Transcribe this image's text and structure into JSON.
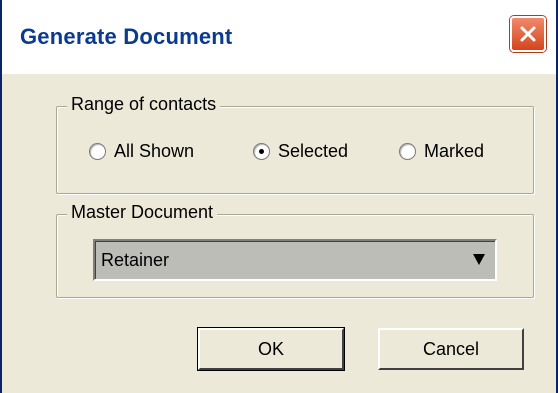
{
  "window": {
    "title": "Generate Document",
    "close_icon": "close-icon"
  },
  "range_group": {
    "label": "Range of contacts",
    "options": [
      {
        "label": "All Shown",
        "checked": false
      },
      {
        "label": "Selected",
        "checked": true
      },
      {
        "label": "Marked",
        "checked": false
      }
    ]
  },
  "master_group": {
    "label": "Master Document",
    "selected_value": "Retainer",
    "arrow_icon": "dropdown-arrow-icon"
  },
  "buttons": {
    "ok_label": "OK",
    "cancel_label": "Cancel"
  }
}
